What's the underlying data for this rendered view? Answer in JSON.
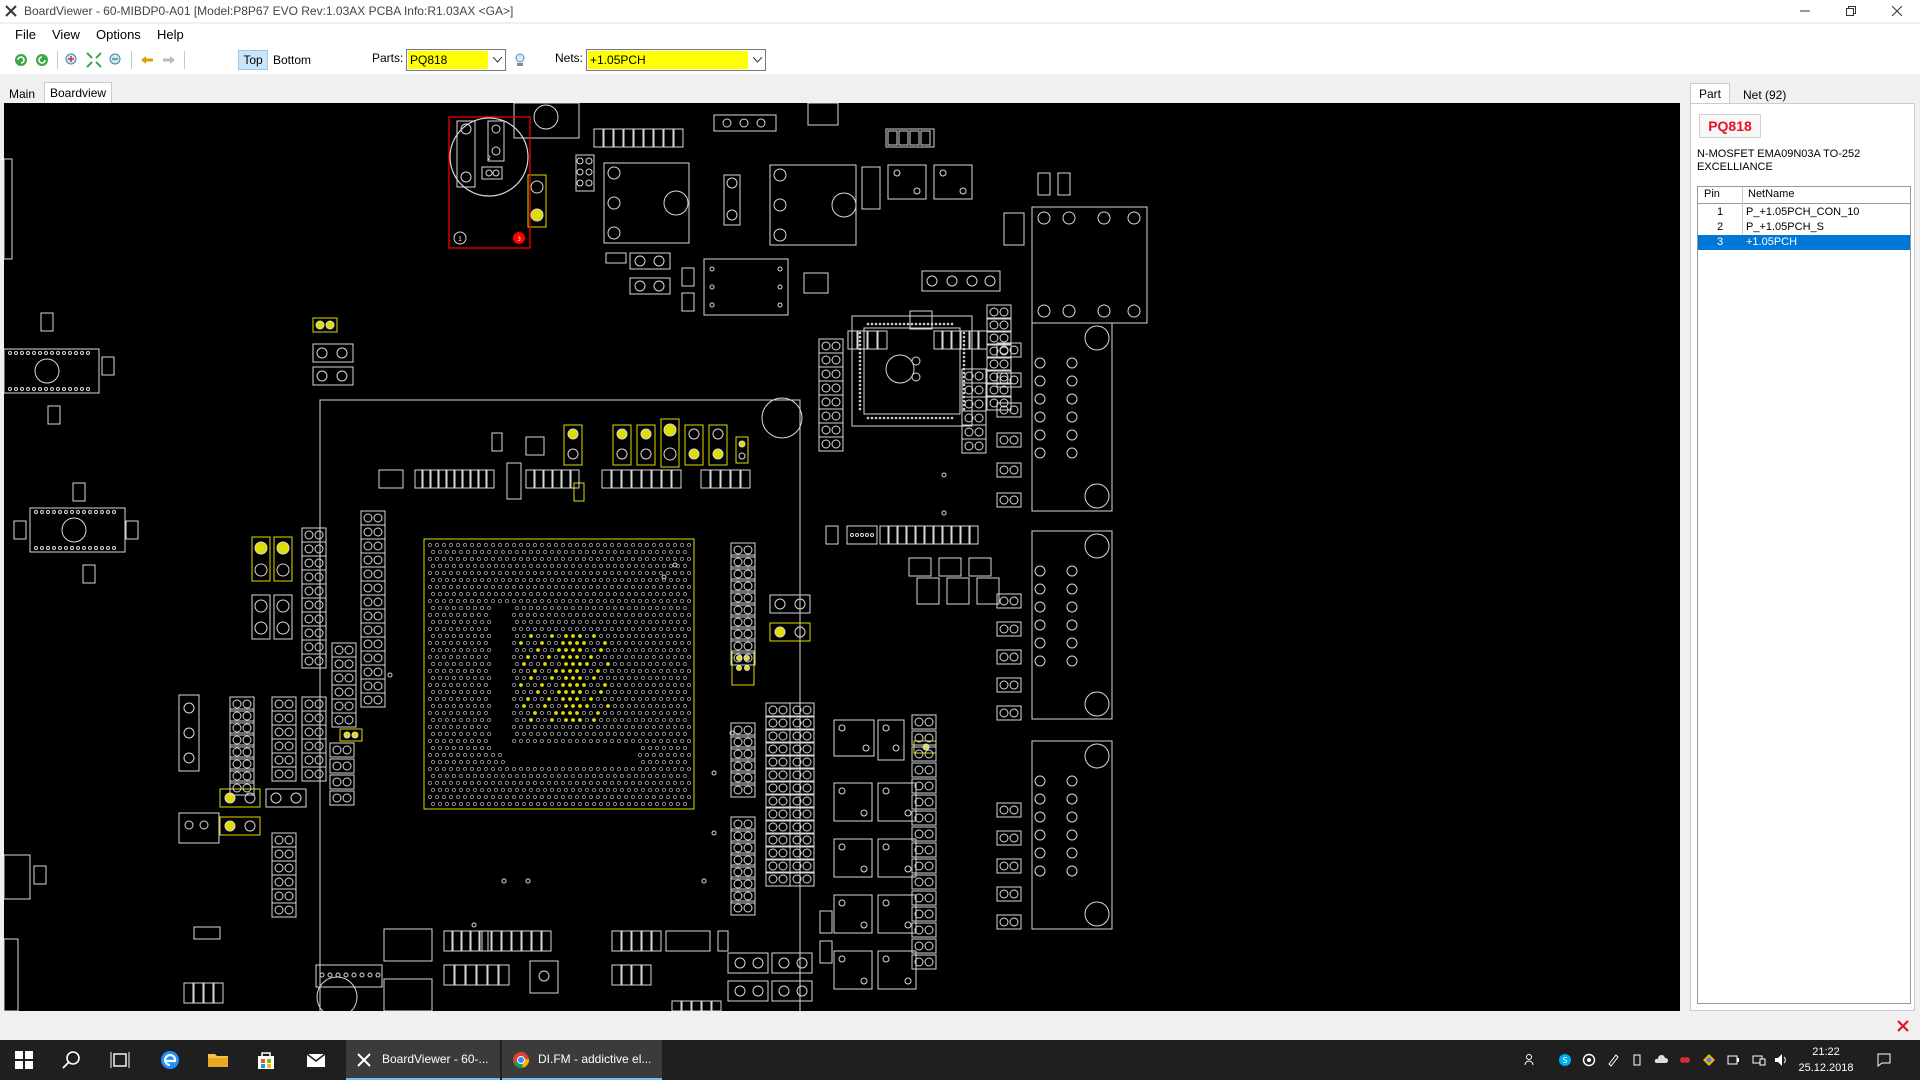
{
  "window": {
    "title": "BoardViewer - 60-MIBDP0-A01 [Model:P8P67 EVO Rev:1.03AX PCBA Info:R1.03AX <GA>]"
  },
  "menu": [
    "File",
    "View",
    "Options",
    "Help"
  ],
  "toolbar": {
    "top_label": "Top",
    "bottom_label": "Bottom",
    "parts_label": "Parts:",
    "parts_value": "PQ818",
    "nets_label": "Nets:",
    "nets_value": "+1.05PCH",
    "icons": [
      "reload-icon",
      "refresh-icon",
      "zoom-in-icon",
      "zoom-fit-icon",
      "zoom-out-icon",
      "back-icon",
      "forward-icon",
      "search-part-icon"
    ]
  },
  "tabs": {
    "main": "Main",
    "boardview": "Boardview"
  },
  "board": {
    "selected_part_pin_labels": [
      "1",
      "2",
      "3"
    ]
  },
  "right_panel": {
    "tab_part": "Part",
    "tab_net": "Net (92)",
    "part_name": "PQ818",
    "part_description": "N-MOSFET EMA09N03A TO-252 EXCELLIANCE",
    "columns": {
      "pin": "Pin",
      "net": "NetName"
    },
    "pins": [
      {
        "pin": "1",
        "net": "P_+1.05PCH_CON_10"
      },
      {
        "pin": "2",
        "net": "P_+1.05PCH_S"
      },
      {
        "pin": "3",
        "net": "+1.05PCH"
      }
    ],
    "selected_pin": "3"
  },
  "taskbar": {
    "apps": [
      {
        "label": "BoardViewer - 60-..."
      },
      {
        "label": "DI.FM - addictive el..."
      }
    ],
    "time": "21:22",
    "date": "25.12.2018"
  },
  "colors": {
    "board_bg": "#000000",
    "outline": "#d8d8d8",
    "highlight": "#e0dc00",
    "selected_part": "#ff0000",
    "selection_blue": "#0078d7"
  }
}
